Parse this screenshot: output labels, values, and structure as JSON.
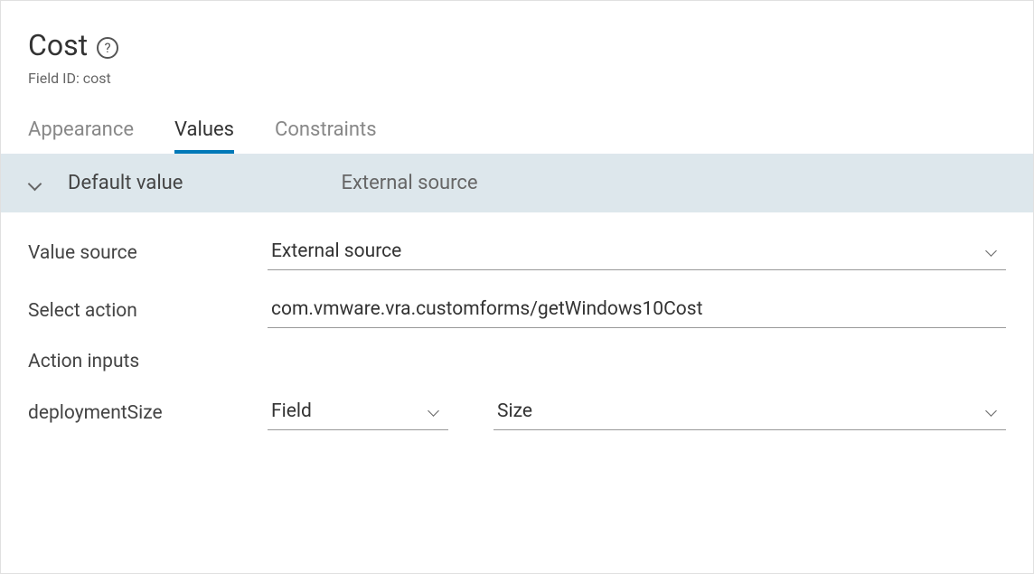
{
  "header": {
    "title": "Cost",
    "helpGlyph": "?",
    "fieldIdLabel": "Field ID: cost"
  },
  "tabs": {
    "appearance": "Appearance",
    "values": "Values",
    "constraints": "Constraints"
  },
  "section": {
    "label": "Default value",
    "value": "External source"
  },
  "form": {
    "valueSource": {
      "label": "Value source",
      "value": "External source"
    },
    "selectAction": {
      "label": "Select action",
      "value": "com.vmware.vra.customforms/getWindows10Cost"
    },
    "actionInputs": {
      "label": "Action inputs"
    },
    "deploymentSize": {
      "label": "deploymentSize",
      "typeValue": "Field",
      "fieldValue": "Size"
    }
  }
}
